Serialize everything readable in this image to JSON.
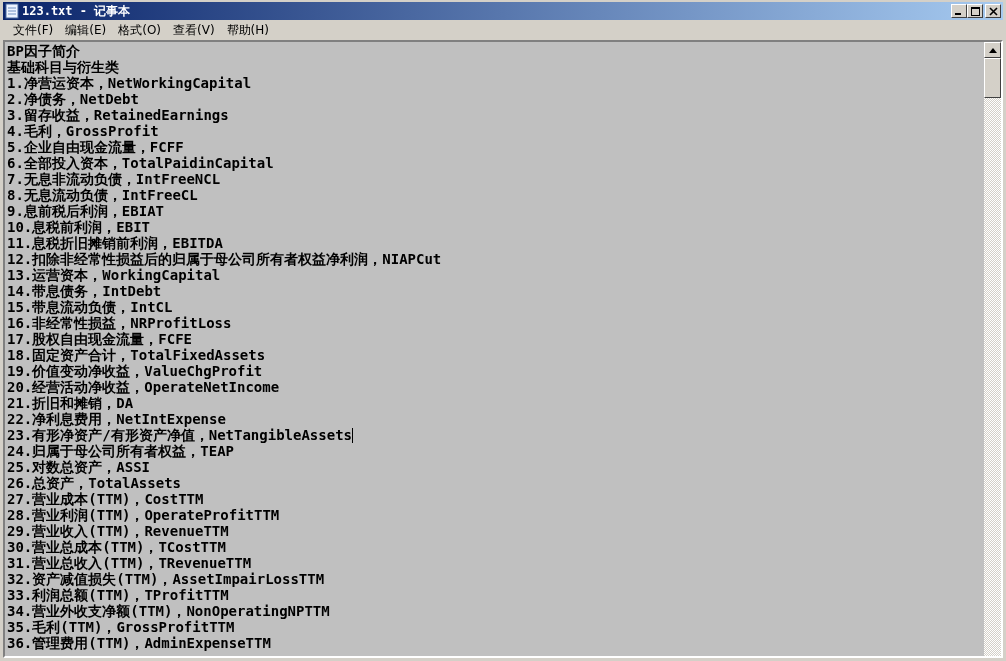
{
  "window": {
    "title": "123.txt - 记事本"
  },
  "menu": [
    "文件(F)",
    "编辑(E)",
    "格式(O)",
    "查看(V)",
    "帮助(H)"
  ],
  "document": {
    "lines": [
      {
        "text": "BP因子简介",
        "caret": false
      },
      {
        "text": "基础科目与衍生类",
        "caret": false
      },
      {
        "text": "1.净营运资本，NetWorkingCapital",
        "caret": false
      },
      {
        "text": "2.净债务，NetDebt",
        "caret": false
      },
      {
        "text": "3.留存收益，RetainedEarnings",
        "caret": false
      },
      {
        "text": "4.毛利，GrossProfit",
        "caret": false
      },
      {
        "text": "5.企业自由现金流量，FCFF",
        "caret": false
      },
      {
        "text": "6.全部投入资本，TotalPaidinCapital",
        "caret": false
      },
      {
        "text": "7.无息非流动负债，IntFreeNCL",
        "caret": false
      },
      {
        "text": "8.无息流动负债，IntFreeCL",
        "caret": false
      },
      {
        "text": "9.息前税后利润，EBIAT",
        "caret": false
      },
      {
        "text": "10.息税前利润，EBIT",
        "caret": false
      },
      {
        "text": "11.息税折旧摊销前利润，EBITDA",
        "caret": false
      },
      {
        "text": "12.扣除非经常性损益后的归属于母公司所有者权益净利润，NIAPCut",
        "caret": false
      },
      {
        "text": "13.运营资本，WorkingCapital",
        "caret": false
      },
      {
        "text": "14.带息债务，IntDebt",
        "caret": false
      },
      {
        "text": "15.带息流动负债，IntCL",
        "caret": false
      },
      {
        "text": "16.非经常性损益，NRProfitLoss",
        "caret": false
      },
      {
        "text": "17.股权自由现金流量，FCFE",
        "caret": false
      },
      {
        "text": "18.固定资产合计，TotalFixedAssets",
        "caret": false
      },
      {
        "text": "19.价值变动净收益，ValueChgProfit",
        "caret": false
      },
      {
        "text": "20.经营活动净收益，OperateNetIncome",
        "caret": false
      },
      {
        "text": "21.折旧和摊销，DA",
        "caret": false
      },
      {
        "text": "22.净利息费用，NetIntExpense",
        "caret": false
      },
      {
        "text": "23.有形净资产/有形资产净值，NetTangibleAssets",
        "caret": true
      },
      {
        "text": "24.归属于母公司所有者权益，TEAP",
        "caret": false
      },
      {
        "text": "25.对数总资产，ASSI",
        "caret": false
      },
      {
        "text": "26.总资产，TotalAssets",
        "caret": false
      },
      {
        "text": "27.营业成本(TTM)，CostTTM",
        "caret": false
      },
      {
        "text": "28.营业利润(TTM)，OperateProfitTTM",
        "caret": false
      },
      {
        "text": "29.营业收入(TTM)，RevenueTTM",
        "caret": false
      },
      {
        "text": "30.营业总成本(TTM)，TCostTTM",
        "caret": false
      },
      {
        "text": "31.营业总收入(TTM)，TRevenueTTM",
        "caret": false
      },
      {
        "text": "32.资产减值损失(TTM)，AssetImpairLossTTM",
        "caret": false
      },
      {
        "text": "33.利润总额(TTM)，TProfitTTM",
        "caret": false
      },
      {
        "text": "34.营业外收支净额(TTM)，NonOperatingNPTTM",
        "caret": false
      },
      {
        "text": "35.毛利(TTM)，GrossProfitTTM",
        "caret": false
      },
      {
        "text": "36.管理费用(TTM)，AdminExpenseTTM",
        "caret": false
      }
    ]
  }
}
